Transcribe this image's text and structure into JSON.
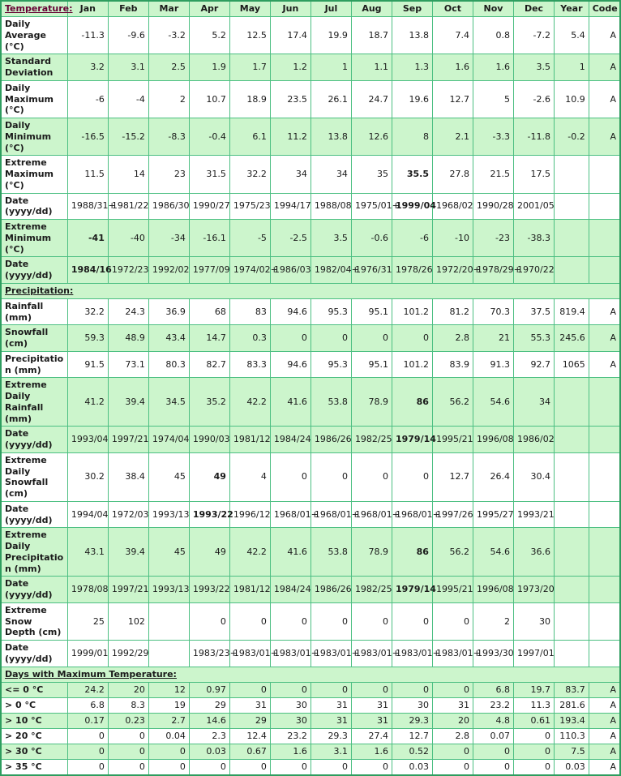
{
  "table": {
    "columns": [
      "Jan",
      "Feb",
      "Mar",
      "Apr",
      "May",
      "Jun",
      "Jul",
      "Aug",
      "Sep",
      "Oct",
      "Nov",
      "Dec",
      "Year",
      "Code"
    ],
    "sections": [
      {
        "title": "Temperature:",
        "rows": [
          {
            "label": "Daily Average (°C)",
            "shade": "white",
            "values": [
              "-11.3",
              "-9.6",
              "-3.2",
              "5.2",
              "12.5",
              "17.4",
              "19.9",
              "18.7",
              "13.8",
              "7.4",
              "0.8",
              "-7.2"
            ],
            "year": "5.4",
            "code": "A",
            "bold": []
          },
          {
            "label": "Standard Deviation",
            "shade": "green",
            "values": [
              "3.2",
              "3.1",
              "2.5",
              "1.9",
              "1.7",
              "1.2",
              "1",
              "1.1",
              "1.3",
              "1.6",
              "1.6",
              "3.5"
            ],
            "year": "1",
            "code": "A",
            "bold": []
          },
          {
            "label": "Daily Maximum (°C)",
            "shade": "white",
            "values": [
              "-6",
              "-4",
              "2",
              "10.7",
              "18.9",
              "23.5",
              "26.1",
              "24.7",
              "19.6",
              "12.7",
              "5",
              "-2.6"
            ],
            "year": "10.9",
            "code": "A",
            "bold": []
          },
          {
            "label": "Daily Minimum (°C)",
            "shade": "green",
            "values": [
              "-16.5",
              "-15.2",
              "-8.3",
              "-0.4",
              "6.1",
              "11.2",
              "13.8",
              "12.6",
              "8",
              "2.1",
              "-3.3",
              "-11.8"
            ],
            "year": "-0.2",
            "code": "A",
            "bold": []
          },
          {
            "label": "Extreme Maximum (°C)",
            "shade": "white",
            "values": [
              "11.5",
              "14",
              "23",
              "31.5",
              "32.2",
              "34",
              "34",
              "35",
              "35.5",
              "27.8",
              "21.5",
              "17.5"
            ],
            "year": "",
            "code": "",
            "bold": [
              8
            ]
          },
          {
            "label": "Date (yyyy/dd)",
            "shade": "white",
            "values": [
              "1988/31+",
              "1981/22",
              "1986/30",
              "1990/27",
              "1975/23",
              "1994/17",
              "1988/08",
              "1975/01+",
              "1999/04",
              "1968/02",
              "1990/28",
              "2001/05"
            ],
            "year": "",
            "code": "",
            "bold": [
              8
            ]
          },
          {
            "label": "Extreme Minimum (°C)",
            "shade": "green",
            "values": [
              "-41",
              "-40",
              "-34",
              "-16.1",
              "-5",
              "-2.5",
              "3.5",
              "-0.6",
              "-6",
              "-10",
              "-23",
              "-38.3"
            ],
            "year": "",
            "code": "",
            "bold": [
              0
            ]
          },
          {
            "label": "Date (yyyy/dd)",
            "shade": "green",
            "values": [
              "1984/16",
              "1972/23",
              "1992/02",
              "1977/09",
              "1974/02+",
              "1986/03",
              "1982/04+",
              "1976/31",
              "1978/26",
              "1972/20+",
              "1978/29+",
              "1970/22"
            ],
            "year": "",
            "code": "",
            "bold": [
              0
            ]
          }
        ]
      },
      {
        "title": "Precipitation:",
        "rows": [
          {
            "label": "Rainfall (mm)",
            "shade": "white",
            "values": [
              "32.2",
              "24.3",
              "36.9",
              "68",
              "83",
              "94.6",
              "95.3",
              "95.1",
              "101.2",
              "81.2",
              "70.3",
              "37.5"
            ],
            "year": "819.4",
            "code": "A",
            "bold": []
          },
          {
            "label": "Snowfall (cm)",
            "shade": "green",
            "values": [
              "59.3",
              "48.9",
              "43.4",
              "14.7",
              "0.3",
              "0",
              "0",
              "0",
              "0",
              "2.8",
              "21",
              "55.3"
            ],
            "year": "245.6",
            "code": "A",
            "bold": []
          },
          {
            "label": "Precipitation (mm)",
            "shade": "white",
            "values": [
              "91.5",
              "73.1",
              "80.3",
              "82.7",
              "83.3",
              "94.6",
              "95.3",
              "95.1",
              "101.2",
              "83.9",
              "91.3",
              "92.7"
            ],
            "year": "1065",
            "code": "A",
            "bold": []
          },
          {
            "label": "Extreme Daily Rainfall (mm)",
            "shade": "green",
            "values": [
              "41.2",
              "39.4",
              "34.5",
              "35.2",
              "42.2",
              "41.6",
              "53.8",
              "78.9",
              "86",
              "56.2",
              "54.6",
              "34"
            ],
            "year": "",
            "code": "",
            "bold": [
              8
            ]
          },
          {
            "label": "Date (yyyy/dd)",
            "shade": "green",
            "values": [
              "1993/04",
              "1997/21",
              "1974/04",
              "1990/03",
              "1981/12",
              "1984/24",
              "1986/26",
              "1982/25",
              "1979/14",
              "1995/21",
              "1996/08",
              "1986/02"
            ],
            "year": "",
            "code": "",
            "bold": [
              8
            ]
          },
          {
            "label": "Extreme Daily Snowfall (cm)",
            "shade": "white",
            "values": [
              "30.2",
              "38.4",
              "45",
              "49",
              "4",
              "0",
              "0",
              "0",
              "0",
              "12.7",
              "26.4",
              "30.4"
            ],
            "year": "",
            "code": "",
            "bold": [
              3
            ]
          },
          {
            "label": "Date (yyyy/dd)",
            "shade": "white",
            "values": [
              "1994/04",
              "1972/03",
              "1993/13",
              "1993/22",
              "1996/12",
              "1968/01+",
              "1968/01+",
              "1968/01+",
              "1968/01+",
              "1997/26",
              "1995/27",
              "1993/21"
            ],
            "year": "",
            "code": "",
            "bold": [
              3
            ]
          },
          {
            "label": "Extreme Daily Precipitation (mm)",
            "shade": "green",
            "values": [
              "43.1",
              "39.4",
              "45",
              "49",
              "42.2",
              "41.6",
              "53.8",
              "78.9",
              "86",
              "56.2",
              "54.6",
              "36.6"
            ],
            "year": "",
            "code": "",
            "bold": [
              8
            ]
          },
          {
            "label": "Date (yyyy/dd)",
            "shade": "green",
            "values": [
              "1978/08",
              "1997/21",
              "1993/13",
              "1993/22",
              "1981/12",
              "1984/24",
              "1986/26",
              "1982/25",
              "1979/14",
              "1995/21",
              "1996/08",
              "1973/20"
            ],
            "year": "",
            "code": "",
            "bold": [
              8
            ]
          },
          {
            "label": "Extreme Snow Depth (cm)",
            "shade": "white",
            "values": [
              "25",
              "102",
              "",
              "0",
              "0",
              "0",
              "0",
              "0",
              "0",
              "0",
              "2",
              "30"
            ],
            "year": "",
            "code": "",
            "bold": []
          },
          {
            "label": "Date (yyyy/dd)",
            "shade": "white",
            "values": [
              "1999/01",
              "1992/29",
              "",
              "1983/23+",
              "1983/01+",
              "1983/01+",
              "1983/01+",
              "1983/01+",
              "1983/01+",
              "1983/01+",
              "1993/30",
              "1997/01"
            ],
            "year": "",
            "code": "",
            "bold": []
          }
        ]
      },
      {
        "title": "Days with Maximum Temperature:",
        "rows": [
          {
            "label": "<= 0 °C",
            "shade": "green",
            "values": [
              "24.2",
              "20",
              "12",
              "0.97",
              "0",
              "0",
              "0",
              "0",
              "0",
              "0",
              "6.8",
              "19.7"
            ],
            "year": "83.7",
            "code": "A",
            "bold": []
          },
          {
            "label": "> 0 °C",
            "shade": "white",
            "values": [
              "6.8",
              "8.3",
              "19",
              "29",
              "31",
              "30",
              "31",
              "31",
              "30",
              "31",
              "23.2",
              "11.3"
            ],
            "year": "281.6",
            "code": "A",
            "bold": []
          },
          {
            "label": "> 10 °C",
            "shade": "green",
            "values": [
              "0.17",
              "0.23",
              "2.7",
              "14.6",
              "29",
              "30",
              "31",
              "31",
              "29.3",
              "20",
              "4.8",
              "0.61"
            ],
            "year": "193.4",
            "code": "A",
            "bold": []
          },
          {
            "label": "> 20 °C",
            "shade": "white",
            "values": [
              "0",
              "0",
              "0.04",
              "2.3",
              "12.4",
              "23.2",
              "29.3",
              "27.4",
              "12.7",
              "2.8",
              "0.07",
              "0"
            ],
            "year": "110.3",
            "code": "A",
            "bold": []
          },
          {
            "label": "> 30 °C",
            "shade": "green",
            "values": [
              "0",
              "0",
              "0",
              "0.03",
              "0.67",
              "1.6",
              "3.1",
              "1.6",
              "0.52",
              "0",
              "0",
              "0"
            ],
            "year": "7.5",
            "code": "A",
            "bold": []
          },
          {
            "label": "> 35 °C",
            "shade": "white",
            "values": [
              "0",
              "0",
              "0",
              "0",
              "0",
              "0",
              "0",
              "0",
              "0.03",
              "0",
              "0",
              "0"
            ],
            "year": "0.03",
            "code": "A",
            "bold": []
          }
        ]
      }
    ]
  },
  "colors": {
    "header_text": "#0000cc",
    "section_text": "#660033",
    "shade_green": "#ccf5cc",
    "border": "#4cbf82",
    "outer_border": "#2e9d5f"
  }
}
